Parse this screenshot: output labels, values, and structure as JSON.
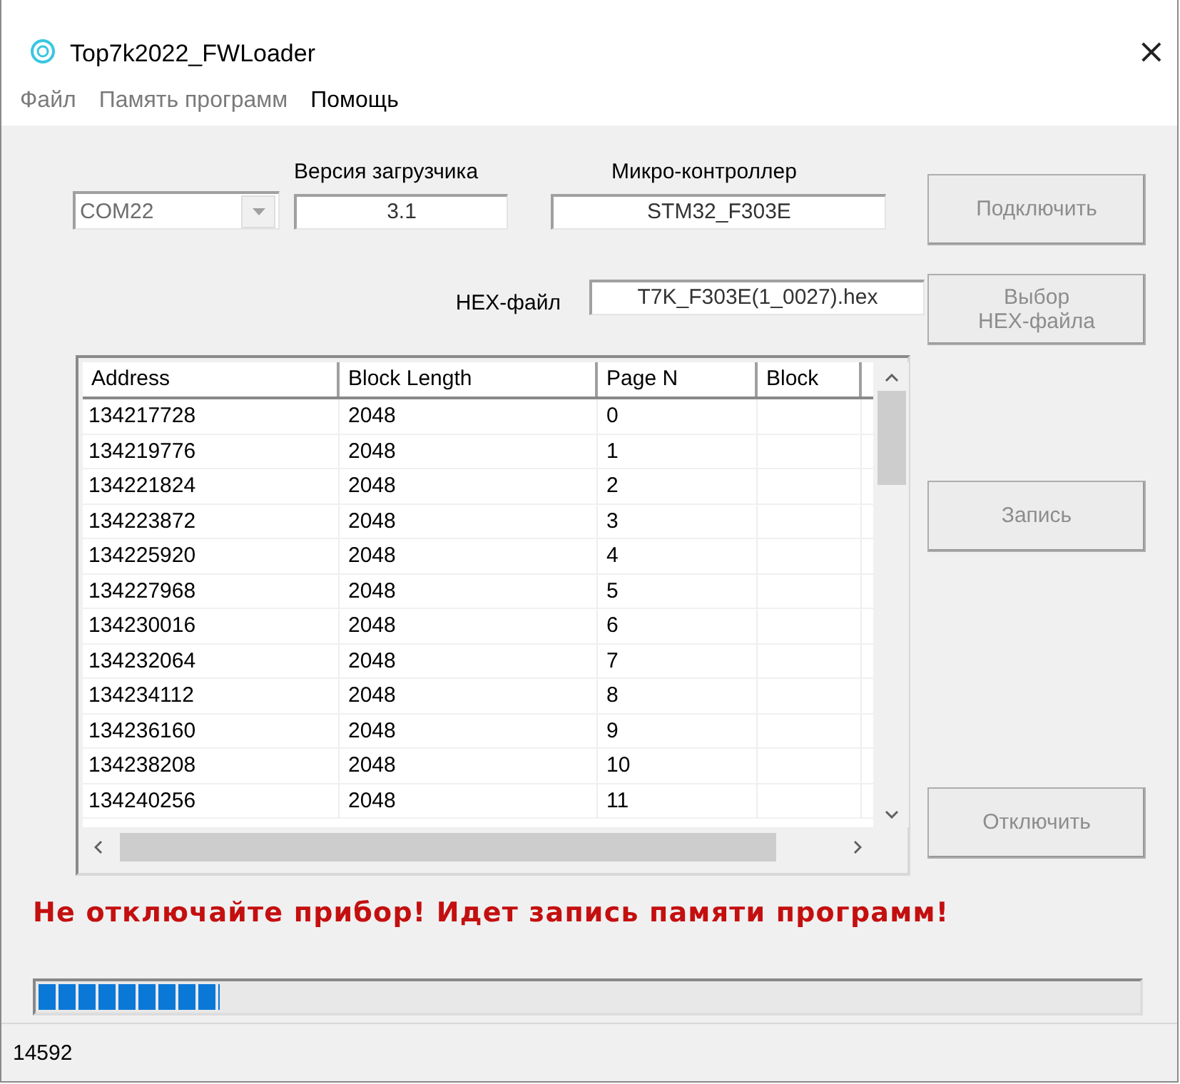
{
  "window": {
    "title": "Top7k2022_FWLoader",
    "close": "×"
  },
  "menu": [
    {
      "label": "Файл",
      "disabled": true
    },
    {
      "label": "Память программ",
      "disabled": true
    },
    {
      "label": "Помощь",
      "disabled": false
    }
  ],
  "port": {
    "value": "COM22",
    "disabled": true
  },
  "loader_version": {
    "label": "Версия загрузчика",
    "value": "3.1"
  },
  "microcontroller": {
    "label": "Микро-контроллер",
    "value": "STM32_F303E"
  },
  "hex_file": {
    "label": "HEX-файл",
    "value": "T7K_F303E(1_0027).hex"
  },
  "buttons": [
    {
      "label": "Подключить",
      "disabled": true
    },
    {
      "label": "Выбор\nHEX-файла",
      "disabled": true
    },
    {
      "label": "Запись",
      "disabled": true
    },
    {
      "label": "Отключить",
      "disabled": true
    }
  ],
  "table": {
    "columns": [
      "Address",
      "Block Length",
      "Page N",
      "Block"
    ],
    "rows": [
      [
        "134217728",
        "2048",
        "0"
      ],
      [
        "134219776",
        "2048",
        "1"
      ],
      [
        "134221824",
        "2048",
        "2"
      ],
      [
        "134223872",
        "2048",
        "3"
      ],
      [
        "134225920",
        "2048",
        "4"
      ],
      [
        "134227968",
        "2048",
        "5"
      ],
      [
        "134230016",
        "2048",
        "6"
      ],
      [
        "134232064",
        "2048",
        "7"
      ],
      [
        "134234112",
        "2048",
        "8"
      ],
      [
        "134236160",
        "2048",
        "9"
      ],
      [
        "134238208",
        "2048",
        "10"
      ],
      [
        "134240256",
        "2048",
        "11"
      ]
    ]
  },
  "warning": "Не отключайте прибор! Идет запись памяти программ!",
  "progress": {
    "level": 0.165
  },
  "status_bar": "14592"
}
